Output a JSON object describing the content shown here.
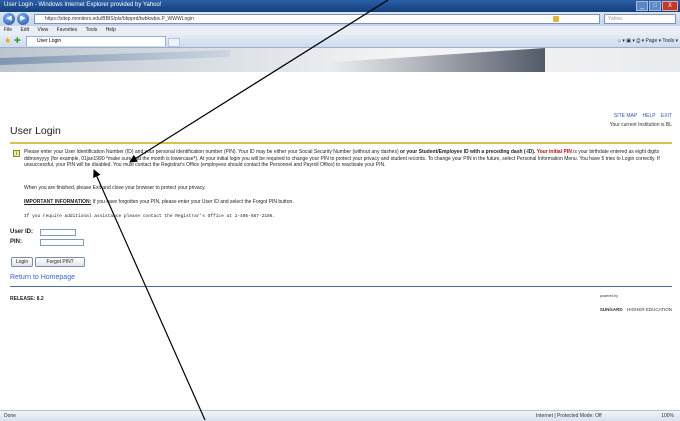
{
  "window": {
    "title": "User Login - Windows Internet Explorer provided by Yahoo!",
    "minimize": "_",
    "maximize": "□",
    "close": "X"
  },
  "browser": {
    "back": "◀",
    "forward": "▶",
    "address": "https://sitep.monitors.edu/BBIS/pls/bbpprd/twbkwbis.P_WWWLogin",
    "search_placeholder": "Yahoo",
    "menu": [
      "File",
      "Edit",
      "View",
      "Favorites",
      "Tools",
      "Help"
    ],
    "tab_title": "User Login",
    "command_bar": "⌂ ▾  ▣ ▾  ⎙ ▾  Page ▾  Tools ▾"
  },
  "page": {
    "title": "User Login",
    "top_links": [
      "SITE MAP",
      "HELP",
      "EXIT"
    ],
    "institution": "Your current Institution is BL",
    "intro": {
      "part1": "Please enter your User Identification Number (ID) and your personal identification number (PIN). Your ID may be either your Social Security Number (without any dashes) ",
      "bold1": "or your Student/Employee ID with a preceding dash (-ID).",
      "red1": " Your initial PIN",
      "part2": " is your birthdate entered as eight digits ddmonyyyy (for example, 01jan1990 *make sure that the month is lowercase*). At your initial login you will be required to change your PIN to protect your privacy and student records. To change your PIN in the future, select Personal Information Menu. You have 5 tries to Login correctly. If unsuccessful, your PIN will be disabled. You must contact the Registrar's Office (employees should contact the Personnel and Payroll Office) to reactivate your PIN."
    },
    "finished_text": "When you are finished, please Exit and close your browser to protect your privacy.",
    "important_label": "IMPORTANT INFORMATION:",
    "important_text": " If you have forgotten your PIN, please enter your User ID and select the Forgot PIN button.",
    "assistance_text": "If you require additional assistance please contact the Registrar's Office at 1-405-587-2186.",
    "user_id_label": "User ID:",
    "pin_label": "PIN:",
    "login_button": "Login",
    "forgot_pin_button": "Forgot PIN?",
    "return_link": "Return to Homepage",
    "release": "RELEASE: 8.2",
    "footer_logo": {
      "powered_by": "powered by",
      "brand": "SUNGARD",
      "division": "HIGHER EDUCATION"
    }
  },
  "status_bar": {
    "status": "Done",
    "zone": "Internet | Protected Mode: Off",
    "zoom": "100%"
  },
  "colors": {
    "yellow_rule": "#d6c44a",
    "blue_rule": "#4a6a96",
    "link": "#3366cc",
    "titlebar": "#1f4e8f"
  },
  "icons": [
    "back-icon",
    "forward-icon",
    "lock-icon",
    "favorites-star-icon",
    "add-favorites-icon",
    "info-icon",
    "annotation-arrow-icon"
  ]
}
